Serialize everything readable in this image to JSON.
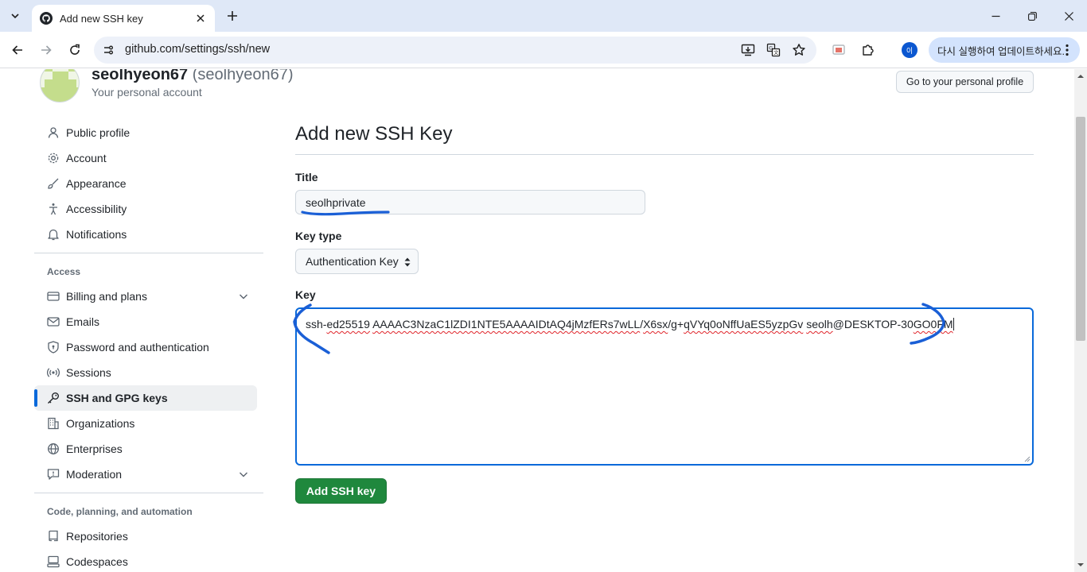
{
  "browser": {
    "tab_title": "Add new SSH key",
    "url": "github.com/settings/ssh/new",
    "update_text": "다시 실행하여 업데이트하세요.",
    "profile_initial": "이"
  },
  "header": {
    "display_name": "seolhyeon67",
    "handle": "(seolhyeon67)",
    "subtitle": "Your personal account",
    "profile_button": "Go to your personal profile"
  },
  "sidebar": {
    "items_top": [
      {
        "label": "Public profile",
        "icon": "person-icon"
      },
      {
        "label": "Account",
        "icon": "gear-icon"
      },
      {
        "label": "Appearance",
        "icon": "paintbrush-icon"
      },
      {
        "label": "Accessibility",
        "icon": "accessibility-icon"
      },
      {
        "label": "Notifications",
        "icon": "bell-icon"
      }
    ],
    "access_heading": "Access",
    "items_access": [
      {
        "label": "Billing and plans",
        "icon": "credit-card-icon",
        "expandable": true
      },
      {
        "label": "Emails",
        "icon": "mail-icon"
      },
      {
        "label": "Password and authentication",
        "icon": "shield-lock-icon"
      },
      {
        "label": "Sessions",
        "icon": "broadcast-icon"
      },
      {
        "label": "SSH and GPG keys",
        "icon": "key-icon",
        "active": true
      },
      {
        "label": "Organizations",
        "icon": "organization-icon"
      },
      {
        "label": "Enterprises",
        "icon": "globe-icon"
      },
      {
        "label": "Moderation",
        "icon": "report-icon",
        "expandable": true
      }
    ],
    "code_heading": "Code, planning, and automation",
    "items_code": [
      {
        "label": "Repositories",
        "icon": "repo-icon"
      },
      {
        "label": "Codespaces",
        "icon": "codespaces-icon"
      }
    ]
  },
  "form": {
    "heading": "Add new SSH Key",
    "title_label": "Title",
    "title_value": "seolhprivate",
    "key_type_label": "Key type",
    "key_type_value": "Authentication Key",
    "key_label": "Key",
    "key_parts": {
      "p1": "ssh-",
      "p2": "ed25519",
      "p3": " ",
      "p4": "AAAAC3NzaC1lZDI1NTE5AAAAIDtAQ4jMzfERs7wLL",
      "p5": "/",
      "p6": "X6sx",
      "p7": "/g+",
      "p8": "qVYq0oNffUaES5yzpGv",
      "p9": " ",
      "p10": "seolh",
      "p11": "@DESKTOP-30",
      "p12": "GO0FM"
    },
    "submit_label": "Add SSH key"
  },
  "colors": {
    "accent_blue": "#0969da",
    "submit_green": "#1f883d",
    "annotation_blue": "#1a5fd6"
  }
}
